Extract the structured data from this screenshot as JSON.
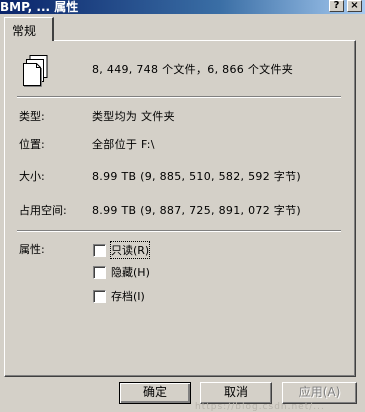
{
  "window": {
    "title": "BMP, ... 属性",
    "help_button": "?",
    "close_button": "×"
  },
  "tabs": [
    {
      "label": "常规",
      "active": true
    }
  ],
  "general": {
    "summary": "8, 449, 748 个文件，6, 866 个文件夹",
    "type_label": "类型:",
    "type_value": "类型均为 文件夹",
    "location_label": "位置:",
    "location_value": "全部位于 F:\\",
    "size_label": "大小:",
    "size_value": "8.99 TB (9, 885, 510, 582, 592 字节)",
    "size_on_disk_label": "占用空间:",
    "size_on_disk_value": "8.99 TB (9, 887, 725, 891, 072 字节)",
    "attributes_label": "属性:",
    "attributes": [
      {
        "label": "只读(R)",
        "checked": false
      },
      {
        "label": "隐藏(H)",
        "checked": false
      },
      {
        "label": "存档(I)",
        "checked": false
      }
    ]
  },
  "buttons": {
    "ok": "确定",
    "cancel": "取消",
    "apply": "应用(A)"
  },
  "watermark": "https://blog.csdn.net/..."
}
